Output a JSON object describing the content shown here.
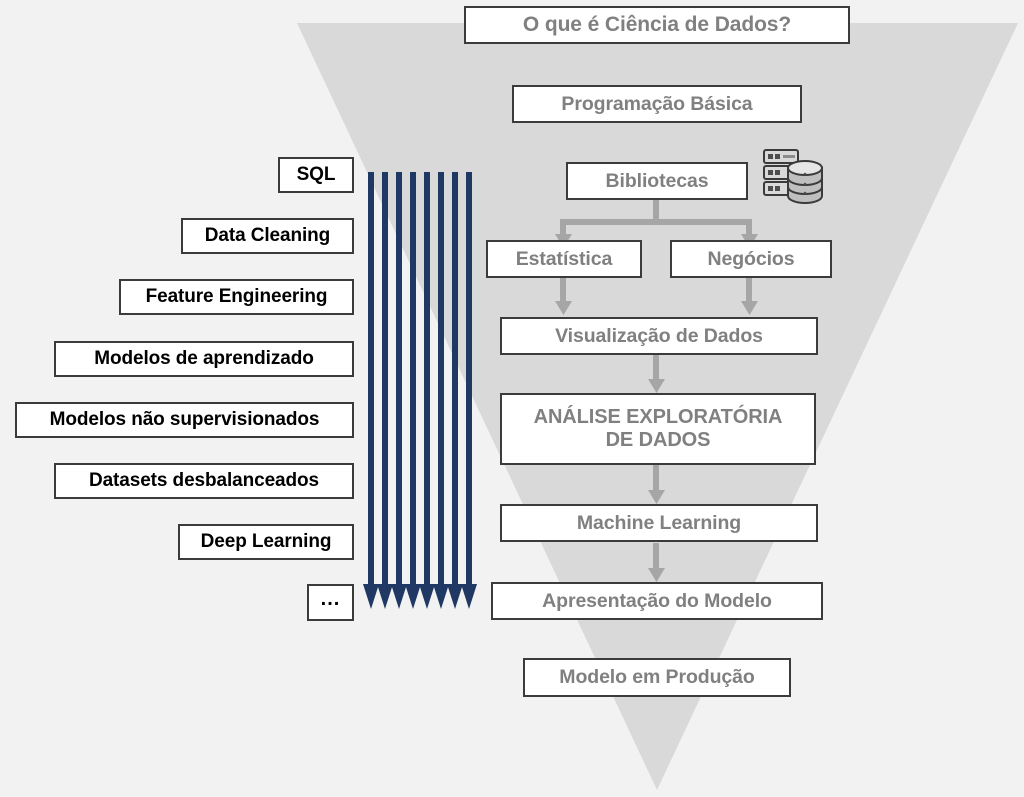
{
  "diagram": {
    "title": "O que é Ciência de Dados?",
    "background_color": "#f2f2f2",
    "funnel_color": "#d9d9d9",
    "arrow_bundle_color": "#1f3864",
    "connector_color": "#a6a6a6",
    "left_text_color": "#000000",
    "right_text_color": "#808080",
    "border_color": "#3b3b3b"
  },
  "header": {
    "title": "O que é Ciência de Dados?",
    "subtitle": "Programação Básica"
  },
  "left_column": {
    "items": [
      {
        "label": "SQL"
      },
      {
        "label": "Data Cleaning"
      },
      {
        "label": "Feature Engineering"
      },
      {
        "label": "Modelos de aprendizado"
      },
      {
        "label": "Modelos não supervisionados"
      },
      {
        "label": "Datasets desbalanceados"
      },
      {
        "label": "Deep Learning"
      },
      {
        "label": "..."
      }
    ]
  },
  "right_column": {
    "libraries": "Bibliotecas",
    "branch_left": "Estatística",
    "branch_right": "Negócios",
    "visualization": "Visualização de Dados",
    "eda": "ANÁLISE EXPLORATÓRIA\nDE DADOS",
    "machine_learning": "Machine Learning",
    "presentation": "Apresentação do Modelo",
    "production": "Modelo em Produção"
  },
  "icons": {
    "database": "database-server-icon"
  },
  "arrow_bundle": {
    "count": 8,
    "color": "#1f3864"
  }
}
